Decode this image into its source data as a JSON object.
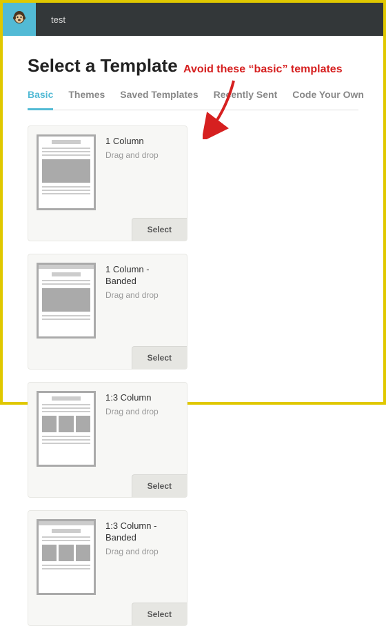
{
  "header": {
    "title": "test"
  },
  "page": {
    "title": "Select a Template"
  },
  "tabs": [
    {
      "label": "Basic",
      "active": true
    },
    {
      "label": "Themes",
      "active": false
    },
    {
      "label": "Saved Templates",
      "active": false
    },
    {
      "label": "Recently Sent",
      "active": false
    },
    {
      "label": "Code Your Own",
      "active": false
    }
  ],
  "templates": [
    {
      "title": "1 Column",
      "subtitle": "Drag and drop",
      "button": "Select",
      "variant": "1col"
    },
    {
      "title": "1 Column - Banded",
      "subtitle": "Drag and drop",
      "button": "Select",
      "variant": "1col-banded"
    },
    {
      "title": "1:3 Column",
      "subtitle": "Drag and drop",
      "button": "Select",
      "variant": "13col"
    },
    {
      "title": "1:3 Column - Banded",
      "subtitle": "Drag and drop",
      "button": "Select",
      "variant": "13col-banded"
    }
  ],
  "annotation": {
    "text": "Avoid these “basic” templates"
  }
}
